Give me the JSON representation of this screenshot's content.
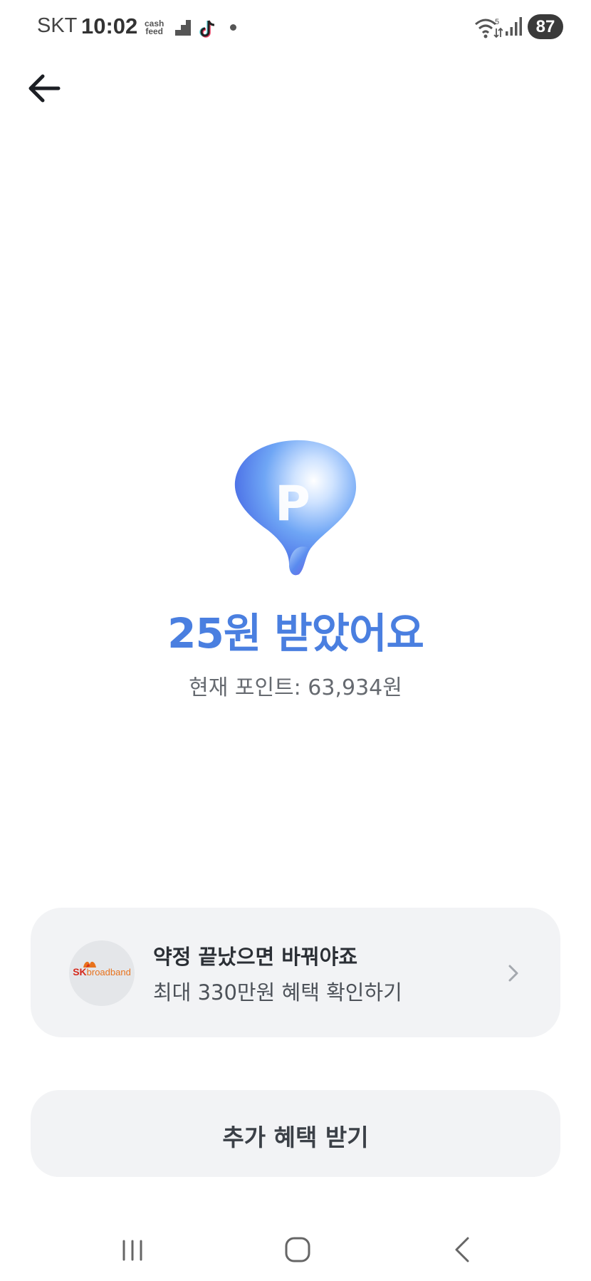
{
  "status_bar": {
    "carrier": "SKT",
    "time": "10:02",
    "cashfeed_line1": "cash",
    "cashfeed_line2": "feed",
    "battery": "87",
    "network": "5"
  },
  "header": {
    "back_icon": "arrow-left-icon"
  },
  "reward": {
    "logo_letter": "P",
    "title": "25원 받았어요",
    "points_text": "현재 포인트: 63,934원"
  },
  "promo": {
    "logo_sk": "SK",
    "logo_broadband": "broadband",
    "title": "약정 끝났으면 바꿔야죠",
    "subtitle": "최대 330만원 혜택 확인하기"
  },
  "extra_benefit": {
    "label": "추가 혜택 받기"
  },
  "colors": {
    "accent": "#4a7fe0",
    "card_bg": "#f2f3f5"
  }
}
